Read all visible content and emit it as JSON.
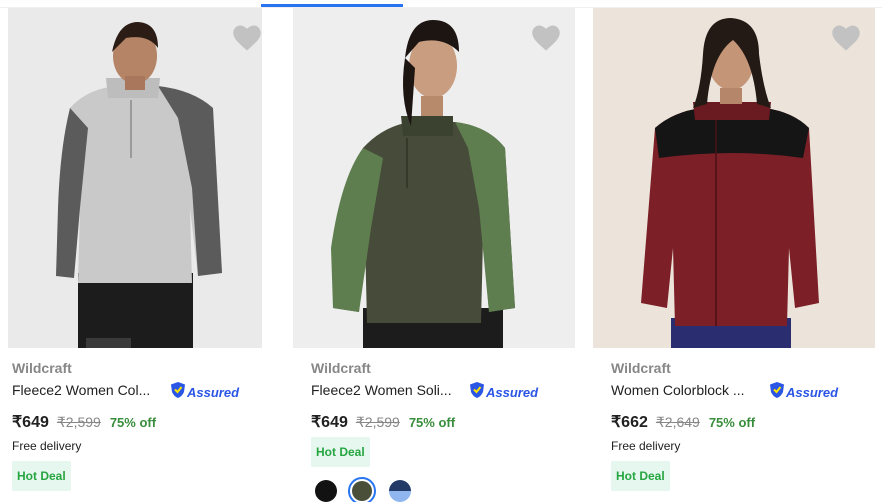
{
  "products": [
    {
      "brand": "Wildcraft",
      "title": "Fleece2 Women Col...",
      "assured_label": "Assured",
      "price": "₹649",
      "mrp": "₹2,599",
      "discount": "75% off",
      "delivery": "Free delivery",
      "deal": "Hot Deal",
      "colors": {
        "body": "#c9c9c9",
        "sleeve": "#5b5b5b",
        "pants": "#1c1c1c",
        "bg": "#eaeaea"
      }
    },
    {
      "brand": "Wildcraft",
      "title": "Fleece2 Women Soli...",
      "assured_label": "Assured",
      "price": "₹649",
      "mrp": "₹2,599",
      "discount": "75% off",
      "delivery": "",
      "deal": "Hot Deal",
      "swatches": [
        "black",
        "olive-green",
        "navy-blue"
      ],
      "colors": {
        "body": "#464c39",
        "sleeve": "#5f7e4f",
        "pants": "#1c1c1c",
        "bg": "#eeeeee"
      }
    },
    {
      "brand": "Wildcraft",
      "title": "Women Colorblock ...",
      "assured_label": "Assured",
      "price": "₹662",
      "mrp": "₹2,649",
      "discount": "75% off",
      "delivery": "Free delivery",
      "deal": "Hot Deal",
      "colors": {
        "body": "#7d1f27",
        "sleeve": "#7d1f27",
        "yoke": "#151515",
        "pants": "#2a2d70",
        "bg": "#ece4da"
      }
    }
  ],
  "icons": {
    "wishlist": "heart-icon",
    "assured": "assured-shield-icon"
  },
  "theme": {
    "accent": "#2874f0",
    "discount_green": "#388e3c",
    "deal_bg": "#e5f7ee",
    "deal_text": "#26a541"
  }
}
